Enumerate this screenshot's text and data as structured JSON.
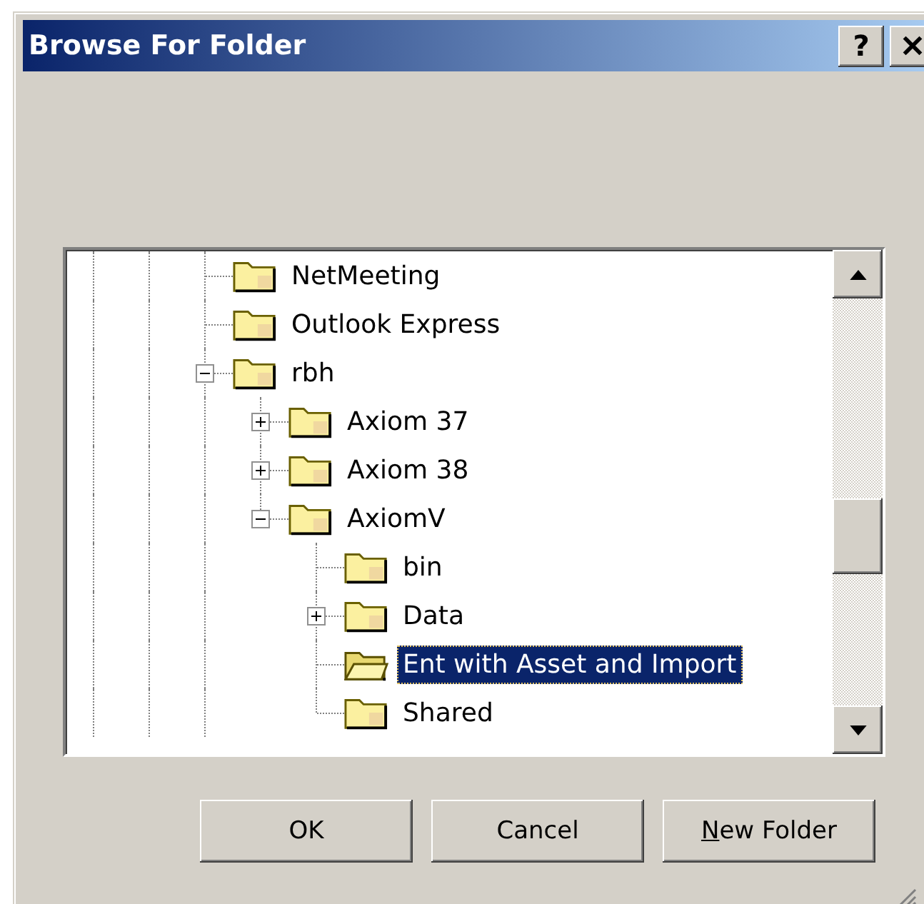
{
  "window": {
    "title": "Browse For Folder",
    "help_button": "?"
  },
  "tree": {
    "items": [
      {
        "label": "NetMeeting",
        "expandable": false,
        "expanded": false,
        "selected": false
      },
      {
        "label": "Outlook Express",
        "expandable": false,
        "expanded": false,
        "selected": false
      },
      {
        "label": "rbh",
        "expandable": true,
        "expanded": true,
        "selected": false,
        "children": [
          {
            "label": "Axiom 37",
            "expandable": true,
            "expanded": false,
            "selected": false
          },
          {
            "label": "Axiom 38",
            "expandable": true,
            "expanded": false,
            "selected": false
          },
          {
            "label": "AxiomV",
            "expandable": true,
            "expanded": true,
            "selected": false,
            "children": [
              {
                "label": "bin",
                "expandable": false,
                "expanded": false,
                "selected": false
              },
              {
                "label": "Data",
                "expandable": true,
                "expanded": false,
                "selected": false
              },
              {
                "label": "Ent with Asset and Import",
                "expandable": false,
                "expanded": false,
                "selected": true
              },
              {
                "label": "Shared",
                "expandable": false,
                "expanded": false,
                "selected": false
              }
            ]
          }
        ]
      }
    ]
  },
  "buttons": [
    {
      "parts": [
        {
          "text": "OK",
          "underlined": false
        }
      ]
    },
    {
      "parts": [
        {
          "text": "Cancel",
          "underlined": false
        }
      ]
    },
    {
      "parts": [
        {
          "text": "N",
          "underlined": true
        },
        {
          "text": "ew Folder",
          "underlined": false
        }
      ]
    }
  ]
}
